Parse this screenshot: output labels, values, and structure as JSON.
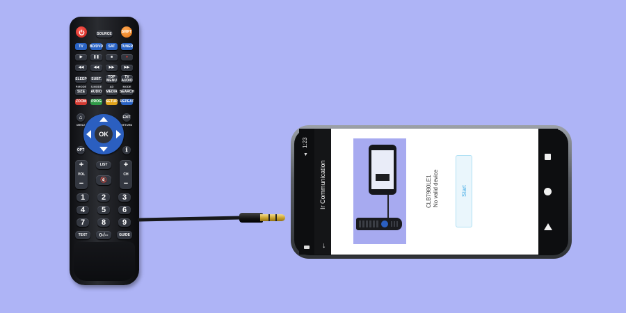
{
  "remote": {
    "top_buttons": {
      "source": "SOURCE",
      "shift": "SHIFT"
    },
    "mode_buttons": [
      "TV",
      "BD/DVD",
      "SAT",
      "TUNER"
    ],
    "transport_icons": [
      "play-icon",
      "pause-icon",
      "stop-icon",
      "record-icon",
      "rewind-icon",
      "back-icon",
      "forward-icon",
      "fast-forward-icon"
    ],
    "func_row1": [
      "SLEEP",
      "SUBT.",
      "TOP MENU",
      "TV AUDIO"
    ],
    "func_row1_sub": [
      "P.MODE",
      "S.MODE",
      "AD",
      "MODE"
    ],
    "func_row2": [
      "SIZE",
      "AUDIO",
      "MEDIA",
      "SEARCH"
    ],
    "color_row": [
      "ZOOM",
      "PROG",
      "SETUP",
      "REPEAT"
    ],
    "color_row_colors": [
      "#d23a32",
      "#2f9a47",
      "#e0a21a",
      "#2a63c4"
    ],
    "menu_label": "MENU",
    "exit_top": "EXIT",
    "exit_label": "RETURN",
    "ok_label": "OK",
    "opt_label": "OPT",
    "list_label": "LIST",
    "vol_label": "VOL",
    "ch_label": "CH",
    "digits": [
      "1",
      "2",
      "3",
      "4",
      "5",
      "6",
      "7",
      "8",
      "9"
    ],
    "text_label": "TEXT",
    "zero_label": "0-/--",
    "guide_label": "GUIDE"
  },
  "phone": {
    "status_time": "1:23",
    "app_title": "Ir Communication",
    "device_name": "CLB7980LE1",
    "device_status": "No valid device",
    "start_label": "Start"
  },
  "colors": {
    "background": "#aeb4f6",
    "accent_blue": "#2a63c4",
    "power_red": "#d8322b",
    "shift_orange": "#f08a24"
  }
}
